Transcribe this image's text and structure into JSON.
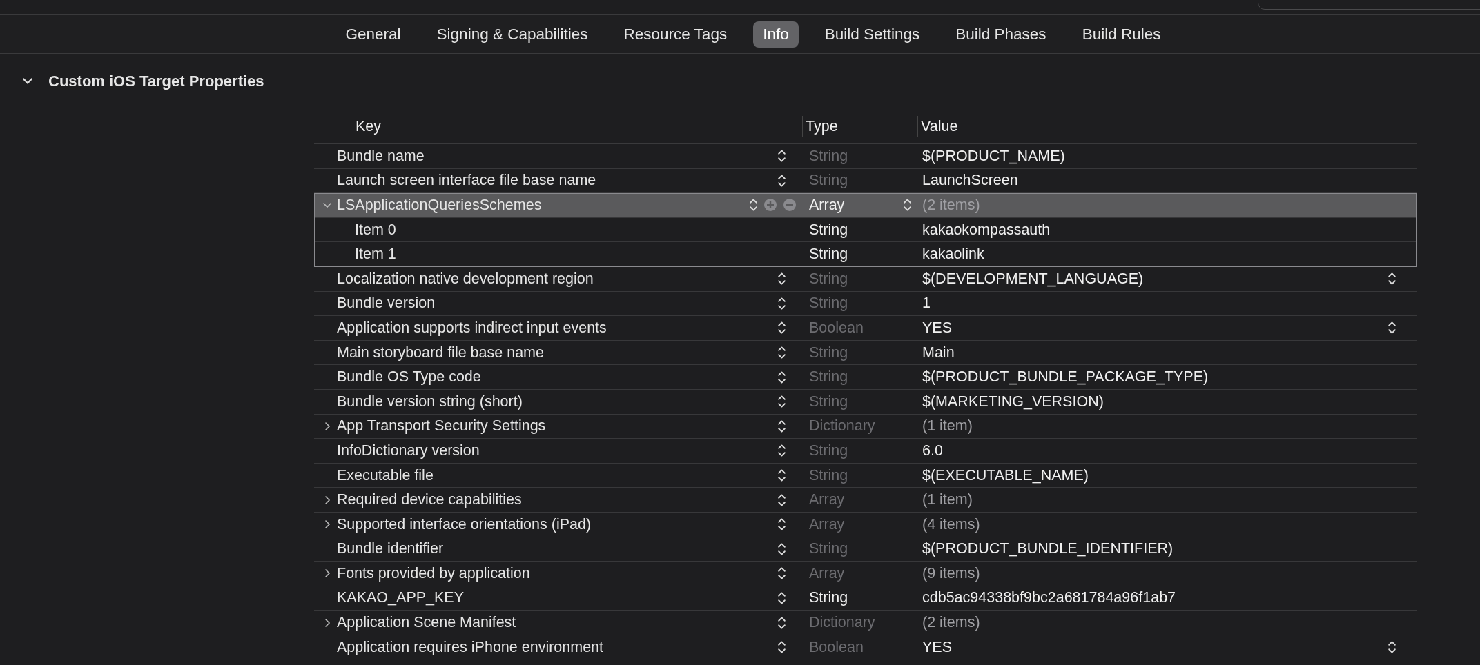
{
  "tabs": [
    {
      "label": "General",
      "selected": false
    },
    {
      "label": "Signing & Capabilities",
      "selected": false
    },
    {
      "label": "Resource Tags",
      "selected": false
    },
    {
      "label": "Info",
      "selected": true
    },
    {
      "label": "Build Settings",
      "selected": false
    },
    {
      "label": "Build Phases",
      "selected": false
    },
    {
      "label": "Build Rules",
      "selected": false
    }
  ],
  "section": {
    "title": "Custom iOS Target Properties",
    "expanded": true
  },
  "columns": [
    "Key",
    "Type",
    "Value"
  ],
  "rows": [
    {
      "key": "Bundle name",
      "type": "String",
      "value": "$(PRODUCT_NAME)",
      "kind": "scalar",
      "selected": false,
      "type_locked": true,
      "value_popup": false
    },
    {
      "key": "Launch screen interface file base name",
      "type": "String",
      "value": "LaunchScreen",
      "kind": "scalar",
      "selected": false,
      "type_locked": true,
      "value_popup": false
    },
    {
      "key": "LSApplicationQueriesSchemes",
      "type": "Array",
      "value": "(2 items)",
      "kind": "collection",
      "expanded": true,
      "selected": true,
      "type_locked": false,
      "value_popup": false,
      "children": [
        {
          "key": "Item 0",
          "type": "String",
          "value": "kakaokompassauth",
          "selected": false
        },
        {
          "key": "Item 1",
          "type": "String",
          "value": "kakaolink",
          "selected": false
        }
      ]
    },
    {
      "key": "Localization native development region",
      "type": "String",
      "value": "$(DEVELOPMENT_LANGUAGE)",
      "kind": "scalar",
      "selected": false,
      "type_locked": true,
      "value_popup": true
    },
    {
      "key": "Bundle version",
      "type": "String",
      "value": "1",
      "kind": "scalar",
      "selected": false,
      "type_locked": true,
      "value_popup": false
    },
    {
      "key": "Application supports indirect input events",
      "type": "Boolean",
      "value": "YES",
      "kind": "scalar",
      "selected": false,
      "type_locked": true,
      "value_popup": true
    },
    {
      "key": "Main storyboard file base name",
      "type": "String",
      "value": "Main",
      "kind": "scalar",
      "selected": false,
      "type_locked": true,
      "value_popup": false
    },
    {
      "key": "Bundle OS Type code",
      "type": "String",
      "value": "$(PRODUCT_BUNDLE_PACKAGE_TYPE)",
      "kind": "scalar",
      "selected": false,
      "type_locked": true,
      "value_popup": false
    },
    {
      "key": "Bundle version string (short)",
      "type": "String",
      "value": "$(MARKETING_VERSION)",
      "kind": "scalar",
      "selected": false,
      "type_locked": true,
      "value_popup": false
    },
    {
      "key": "App Transport Security Settings",
      "type": "Dictionary",
      "value": "(1 item)",
      "kind": "collection",
      "expanded": false,
      "selected": false,
      "type_locked": true,
      "value_popup": false
    },
    {
      "key": "InfoDictionary version",
      "type": "String",
      "value": "6.0",
      "kind": "scalar",
      "selected": false,
      "type_locked": true,
      "value_popup": false
    },
    {
      "key": "Executable file",
      "type": "String",
      "value": "$(EXECUTABLE_NAME)",
      "kind": "scalar",
      "selected": false,
      "type_locked": true,
      "value_popup": false
    },
    {
      "key": "Required device capabilities",
      "type": "Array",
      "value": "(1 item)",
      "kind": "collection",
      "expanded": false,
      "selected": false,
      "type_locked": true,
      "value_popup": false
    },
    {
      "key": "Supported interface orientations (iPad)",
      "type": "Array",
      "value": "(4 items)",
      "kind": "collection",
      "expanded": false,
      "selected": false,
      "type_locked": true,
      "value_popup": false
    },
    {
      "key": "Bundle identifier",
      "type": "String",
      "value": "$(PRODUCT_BUNDLE_IDENTIFIER)",
      "kind": "scalar",
      "selected": false,
      "type_locked": true,
      "value_popup": false
    },
    {
      "key": "Fonts provided by application",
      "type": "Array",
      "value": "(9 items)",
      "kind": "collection",
      "expanded": false,
      "selected": false,
      "type_locked": true,
      "value_popup": false
    },
    {
      "key": "KAKAO_APP_KEY",
      "type": "String",
      "value": "cdb5ac94338bf9bc2a681784a96f1ab7",
      "kind": "scalar",
      "selected": false,
      "type_locked": false,
      "value_popup": false
    },
    {
      "key": "Application Scene Manifest",
      "type": "Dictionary",
      "value": "(2 items)",
      "kind": "collection",
      "expanded": false,
      "selected": false,
      "type_locked": true,
      "value_popup": false
    },
    {
      "key": "Application requires iPhone environment",
      "type": "Boolean",
      "value": "YES",
      "kind": "scalar",
      "selected": false,
      "type_locked": true,
      "value_popup": true
    }
  ]
}
